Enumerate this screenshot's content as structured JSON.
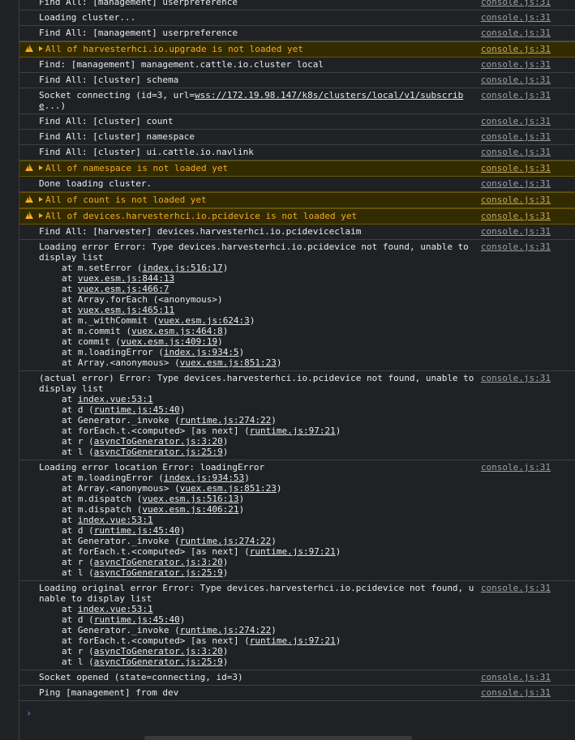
{
  "prompt": {
    "caret": "›"
  },
  "messages": [
    {
      "type": "log",
      "segments": [
        {
          "t": "Find All: [management] userpreference"
        }
      ],
      "source": "console.js:31"
    },
    {
      "type": "log",
      "segments": [
        {
          "t": "Loading cluster..."
        }
      ],
      "source": "console.js:31"
    },
    {
      "type": "log",
      "segments": [
        {
          "t": "Find All: [management] userpreference"
        }
      ],
      "source": "console.js:31"
    },
    {
      "type": "warn",
      "segments": [
        {
          "t": "All of harvesterhci.io.upgrade is not loaded yet"
        }
      ],
      "source": "console.js:31"
    },
    {
      "type": "log",
      "segments": [
        {
          "t": "Find: [management] management.cattle.io.cluster local"
        }
      ],
      "source": "console.js:31"
    },
    {
      "type": "log",
      "segments": [
        {
          "t": "Find All: [cluster] schema"
        }
      ],
      "source": "console.js:31"
    },
    {
      "type": "log",
      "segments": [
        {
          "t": "Socket connecting (id=3, url="
        },
        {
          "t": "wss://172.19.98.147/k8s/clusters/local/v1/subscribe",
          "link": true
        },
        {
          "t": "...)"
        }
      ],
      "source": "console.js:31"
    },
    {
      "type": "log",
      "segments": [
        {
          "t": "Find All: [cluster] count"
        }
      ],
      "source": "console.js:31"
    },
    {
      "type": "log",
      "segments": [
        {
          "t": "Find All: [cluster] namespace"
        }
      ],
      "source": "console.js:31"
    },
    {
      "type": "log",
      "segments": [
        {
          "t": "Find All: [cluster] ui.cattle.io.navlink"
        }
      ],
      "source": "console.js:31"
    },
    {
      "type": "warn",
      "segments": [
        {
          "t": "All of namespace is not loaded yet"
        }
      ],
      "source": "console.js:31"
    },
    {
      "type": "log",
      "segments": [
        {
          "t": "Done loading cluster."
        }
      ],
      "source": "console.js:31"
    },
    {
      "type": "warn",
      "segments": [
        {
          "t": "All of count is not loaded yet"
        }
      ],
      "source": "console.js:31"
    },
    {
      "type": "warn",
      "segments": [
        {
          "t": "All of devices.harvesterhci.io.pcidevice is not loaded yet"
        }
      ],
      "source": "console.js:31"
    },
    {
      "type": "log",
      "segments": [
        {
          "t": "Find All: [harvester] devices.harvesterhci.io.pcideviceclaim"
        }
      ],
      "source": "console.js:31"
    },
    {
      "type": "log",
      "segments": [
        {
          "t": "Loading error Error: Type devices.harvesterhci.io.pcidevice not found, unable to display list"
        }
      ],
      "source": "console.js:31",
      "frames": [
        [
          {
            "t": "at m.setError ("
          },
          {
            "t": "index.js:516:17",
            "link": true
          },
          {
            "t": ")"
          }
        ],
        [
          {
            "t": "at "
          },
          {
            "t": "vuex.esm.js:844:13",
            "link": true
          }
        ],
        [
          {
            "t": "at "
          },
          {
            "t": "vuex.esm.js:466:7",
            "link": true
          }
        ],
        [
          {
            "t": "at Array.forEach (<anonymous>)"
          }
        ],
        [
          {
            "t": "at "
          },
          {
            "t": "vuex.esm.js:465:11",
            "link": true
          }
        ],
        [
          {
            "t": "at m._withCommit ("
          },
          {
            "t": "vuex.esm.js:624:3",
            "link": true
          },
          {
            "t": ")"
          }
        ],
        [
          {
            "t": "at m.commit ("
          },
          {
            "t": "vuex.esm.js:464:8",
            "link": true
          },
          {
            "t": ")"
          }
        ],
        [
          {
            "t": "at commit ("
          },
          {
            "t": "vuex.esm.js:409:19",
            "link": true
          },
          {
            "t": ")"
          }
        ],
        [
          {
            "t": "at m.loadingError ("
          },
          {
            "t": "index.js:934:5",
            "link": true
          },
          {
            "t": ")"
          }
        ],
        [
          {
            "t": "at Array.<anonymous> ("
          },
          {
            "t": "vuex.esm.js:851:23",
            "link": true
          },
          {
            "t": ")"
          }
        ]
      ]
    },
    {
      "type": "log",
      "segments": [
        {
          "t": "(actual error) Error: Type devices.harvesterhci.io.pcidevice not found, unable to display list"
        }
      ],
      "source": "console.js:31",
      "frames": [
        [
          {
            "t": "at "
          },
          {
            "t": "index.vue:53:1",
            "link": true
          }
        ],
        [
          {
            "t": "at d ("
          },
          {
            "t": "runtime.js:45:40",
            "link": true
          },
          {
            "t": ")"
          }
        ],
        [
          {
            "t": "at Generator._invoke ("
          },
          {
            "t": "runtime.js:274:22",
            "link": true
          },
          {
            "t": ")"
          }
        ],
        [
          {
            "t": "at forEach.t.<computed> [as next] ("
          },
          {
            "t": "runtime.js:97:21",
            "link": true
          },
          {
            "t": ")"
          }
        ],
        [
          {
            "t": "at r ("
          },
          {
            "t": "asyncToGenerator.js:3:20",
            "link": true
          },
          {
            "t": ")"
          }
        ],
        [
          {
            "t": "at l ("
          },
          {
            "t": "asyncToGenerator.js:25:9",
            "link": true
          },
          {
            "t": ")"
          }
        ]
      ]
    },
    {
      "type": "log",
      "segments": [
        {
          "t": "Loading error location Error: loadingError"
        }
      ],
      "source": "console.js:31",
      "frames": [
        [
          {
            "t": "at m.loadingError ("
          },
          {
            "t": "index.js:934:53",
            "link": true
          },
          {
            "t": ")"
          }
        ],
        [
          {
            "t": "at Array.<anonymous> ("
          },
          {
            "t": "vuex.esm.js:851:23",
            "link": true
          },
          {
            "t": ")"
          }
        ],
        [
          {
            "t": "at m.dispatch ("
          },
          {
            "t": "vuex.esm.js:516:13",
            "link": true
          },
          {
            "t": ")"
          }
        ],
        [
          {
            "t": "at m.dispatch ("
          },
          {
            "t": "vuex.esm.js:406:21",
            "link": true
          },
          {
            "t": ")"
          }
        ],
        [
          {
            "t": "at "
          },
          {
            "t": "index.vue:53:1",
            "link": true
          }
        ],
        [
          {
            "t": "at d ("
          },
          {
            "t": "runtime.js:45:40",
            "link": true
          },
          {
            "t": ")"
          }
        ],
        [
          {
            "t": "at Generator._invoke ("
          },
          {
            "t": "runtime.js:274:22",
            "link": true
          },
          {
            "t": ")"
          }
        ],
        [
          {
            "t": "at forEach.t.<computed> [as next] ("
          },
          {
            "t": "runtime.js:97:21",
            "link": true
          },
          {
            "t": ")"
          }
        ],
        [
          {
            "t": "at r ("
          },
          {
            "t": "asyncToGenerator.js:3:20",
            "link": true
          },
          {
            "t": ")"
          }
        ],
        [
          {
            "t": "at l ("
          },
          {
            "t": "asyncToGenerator.js:25:9",
            "link": true
          },
          {
            "t": ")"
          }
        ]
      ]
    },
    {
      "type": "log",
      "segments": [
        {
          "t": "Loading original error Error: Type devices.harvesterhci.io.pcidevice not found, unable to display list"
        }
      ],
      "source": "console.js:31",
      "frames": [
        [
          {
            "t": "at "
          },
          {
            "t": "index.vue:53:1",
            "link": true
          }
        ],
        [
          {
            "t": "at d ("
          },
          {
            "t": "runtime.js:45:40",
            "link": true
          },
          {
            "t": ")"
          }
        ],
        [
          {
            "t": "at Generator._invoke ("
          },
          {
            "t": "runtime.js:274:22",
            "link": true
          },
          {
            "t": ")"
          }
        ],
        [
          {
            "t": "at forEach.t.<computed> [as next] ("
          },
          {
            "t": "runtime.js:97:21",
            "link": true
          },
          {
            "t": ")"
          }
        ],
        [
          {
            "t": "at r ("
          },
          {
            "t": "asyncToGenerator.js:3:20",
            "link": true
          },
          {
            "t": ")"
          }
        ],
        [
          {
            "t": "at l ("
          },
          {
            "t": "asyncToGenerator.js:25:9",
            "link": true
          },
          {
            "t": ")"
          }
        ]
      ]
    },
    {
      "type": "log",
      "segments": [
        {
          "t": "Socket opened (state=connecting, id=3)"
        }
      ],
      "source": "console.js:31"
    },
    {
      "type": "log",
      "segments": [
        {
          "t": "Ping [management] from dev"
        }
      ],
      "source": "console.js:31"
    }
  ]
}
